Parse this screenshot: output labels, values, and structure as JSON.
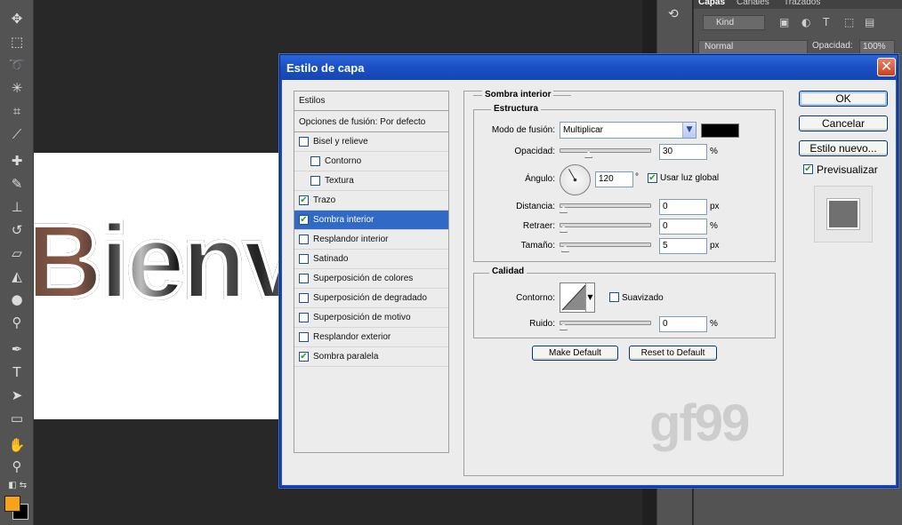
{
  "workspace": {
    "canvas_text": "Bienv",
    "toolbar_icons": [
      "move-icon",
      "marquee-icon",
      "lasso-icon",
      "magic-wand-icon",
      "crop-icon",
      "eyedropper-icon",
      "healing-brush-icon",
      "brush-icon",
      "stamp-icon",
      "history-brush-icon",
      "eraser-icon",
      "paint-bucket-icon",
      "blur-icon",
      "dodge-icon",
      "pen-icon",
      "type-icon",
      "path-selection-icon",
      "rectangle-icon",
      "hand-icon",
      "zoom-icon"
    ],
    "colors": {
      "foreground": "#f7a21b",
      "background": "#000000"
    }
  },
  "layers_panel": {
    "tabs": [
      "Capas",
      "Canales",
      "Trazados"
    ],
    "kind_label": "Kind",
    "blend_mode": "Normal",
    "opacity_label": "Opacidad:",
    "opacity_value": "100%"
  },
  "dialog": {
    "title": "Estilo de capa",
    "close_glyph": "✕",
    "styles_header": "Estilos",
    "blend_options": "Opciones de fusión: Por defecto",
    "styles": [
      {
        "label": "Bisel y relieve",
        "checked": false,
        "indent": false,
        "selected": false
      },
      {
        "label": "Contorno",
        "checked": false,
        "indent": true,
        "selected": false
      },
      {
        "label": "Textura",
        "checked": false,
        "indent": true,
        "selected": false
      },
      {
        "label": "Trazo",
        "checked": true,
        "indent": false,
        "selected": false
      },
      {
        "label": "Sombra interior",
        "checked": true,
        "indent": false,
        "selected": true
      },
      {
        "label": "Resplandor interior",
        "checked": false,
        "indent": false,
        "selected": false
      },
      {
        "label": "Satinado",
        "checked": false,
        "indent": false,
        "selected": false
      },
      {
        "label": "Superposición de colores",
        "checked": false,
        "indent": false,
        "selected": false
      },
      {
        "label": "Superposición de degradado",
        "checked": false,
        "indent": false,
        "selected": false
      },
      {
        "label": "Superposición de motivo",
        "checked": false,
        "indent": false,
        "selected": false
      },
      {
        "label": "Resplandor exterior",
        "checked": false,
        "indent": false,
        "selected": false
      },
      {
        "label": "Sombra paralela",
        "checked": true,
        "indent": false,
        "selected": false
      }
    ],
    "section_title": "Sombra interior",
    "structure": {
      "title": "Estructura",
      "blend_mode_label": "Modo de fusión:",
      "blend_mode_value": "Multiplicar",
      "shadow_color": "#000000",
      "opacity_label": "Opacidad:",
      "opacity_value": "30",
      "opacity_fraction": 0.3,
      "percent": "%",
      "angle_label": "Ángulo:",
      "angle_value": "120",
      "angle_degrees": 120,
      "degree": "°",
      "global_light_label": "Usar luz global",
      "global_light_checked": true,
      "distance_label": "Distancia:",
      "distance_value": "0",
      "distance_fraction": 0.0,
      "choke_label": "Retraer:",
      "choke_value": "0",
      "choke_fraction": 0.0,
      "size_label": "Tamaño:",
      "size_value": "5",
      "size_fraction": 0.02,
      "px": "px"
    },
    "quality": {
      "title": "Calidad",
      "contour_label": "Contorno:",
      "antialias_label": "Suavizado",
      "antialias_checked": false,
      "noise_label": "Ruido:",
      "noise_value": "0",
      "noise_fraction": 0.0
    },
    "make_default": "Make Default",
    "reset_default": "Reset to Default",
    "ok": "OK",
    "cancel": "Cancelar",
    "new_style": "Estilo nuevo...",
    "preview_label": "Previsualizar",
    "preview_checked": true,
    "watermark": "gf99"
  }
}
